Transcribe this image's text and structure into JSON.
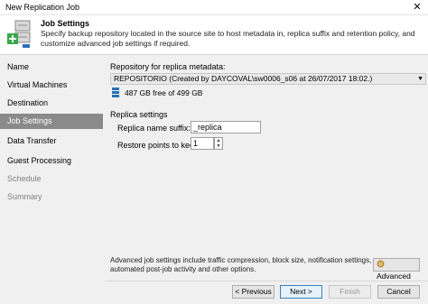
{
  "window": {
    "title": "New Replication Job",
    "close_glyph": "✕"
  },
  "header": {
    "title": "Job Settings",
    "description": "Specify backup repository located in the source site to host metadata in, replica suffix and retention policy, and customize advanced job settings if required.",
    "icon": "replication-job-icon"
  },
  "sidebar": {
    "items": [
      {
        "label": "Name",
        "state": "normal"
      },
      {
        "label": "Virtual Machines",
        "state": "normal"
      },
      {
        "label": "Destination",
        "state": "normal"
      },
      {
        "label": "Job Settings",
        "state": "active"
      },
      {
        "label": "Data Transfer",
        "state": "normal"
      },
      {
        "label": "Guest Processing",
        "state": "normal"
      },
      {
        "label": "Schedule",
        "state": "disabled"
      },
      {
        "label": "Summary",
        "state": "disabled"
      }
    ]
  },
  "repository": {
    "label": "Repository for replica metadata:",
    "selected": "REPOSITORIO (Created by DAYCOVAL\\sw0006_s06 at 26/07/2017 18:02.)",
    "free_space": "487 GB free of 499 GB"
  },
  "replica_settings": {
    "section_label": "Replica settings",
    "name_suffix_label": "Replica name suffix:",
    "name_suffix_value": "_replica",
    "restore_points_label": "Restore points to keep:",
    "restore_points_value": "1"
  },
  "advanced": {
    "description": "Advanced job settings include traffic compression, block size, notification settings, automated post-job activity and other options.",
    "button_label": "Advanced"
  },
  "buttons": {
    "previous": "< Previous",
    "next": "Next >",
    "finish": "Finish",
    "cancel": "Cancel"
  },
  "colors": {
    "active_nav": "#8a8a8a",
    "icon_green": "#3aa84a",
    "icon_blue": "#2a6fb5"
  }
}
